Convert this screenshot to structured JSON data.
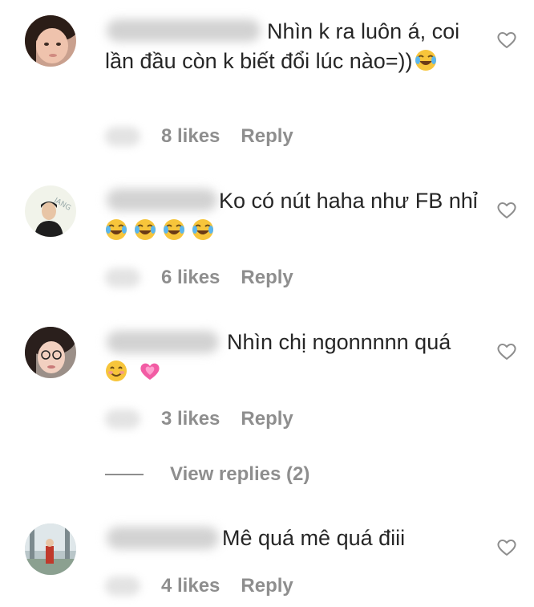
{
  "comments": [
    {
      "text": "Nhìn k ra luôn á, coi lần đầu còn k biết đổi lúc nào=))",
      "likes": "8 likes",
      "reply": "Reply"
    },
    {
      "text": "Ko có nút haha như FB nhỉ",
      "likes": "6 likes",
      "reply": "Reply"
    },
    {
      "text": "Nhìn chị ngonnnnn quá",
      "likes": "3 likes",
      "reply": "Reply"
    },
    {
      "text": "Mê quá mê quá điii",
      "likes": "4 likes",
      "reply": "Reply"
    }
  ],
  "view_replies": "View replies (2)",
  "colors": {
    "text": "#262626",
    "meta": "#8e8e8e",
    "background": "#ffffff"
  },
  "icons": [
    "heart-icon",
    "face-with-tears-of-joy-emoji",
    "smiling-face-emoji",
    "growing-heart-emoji"
  ]
}
